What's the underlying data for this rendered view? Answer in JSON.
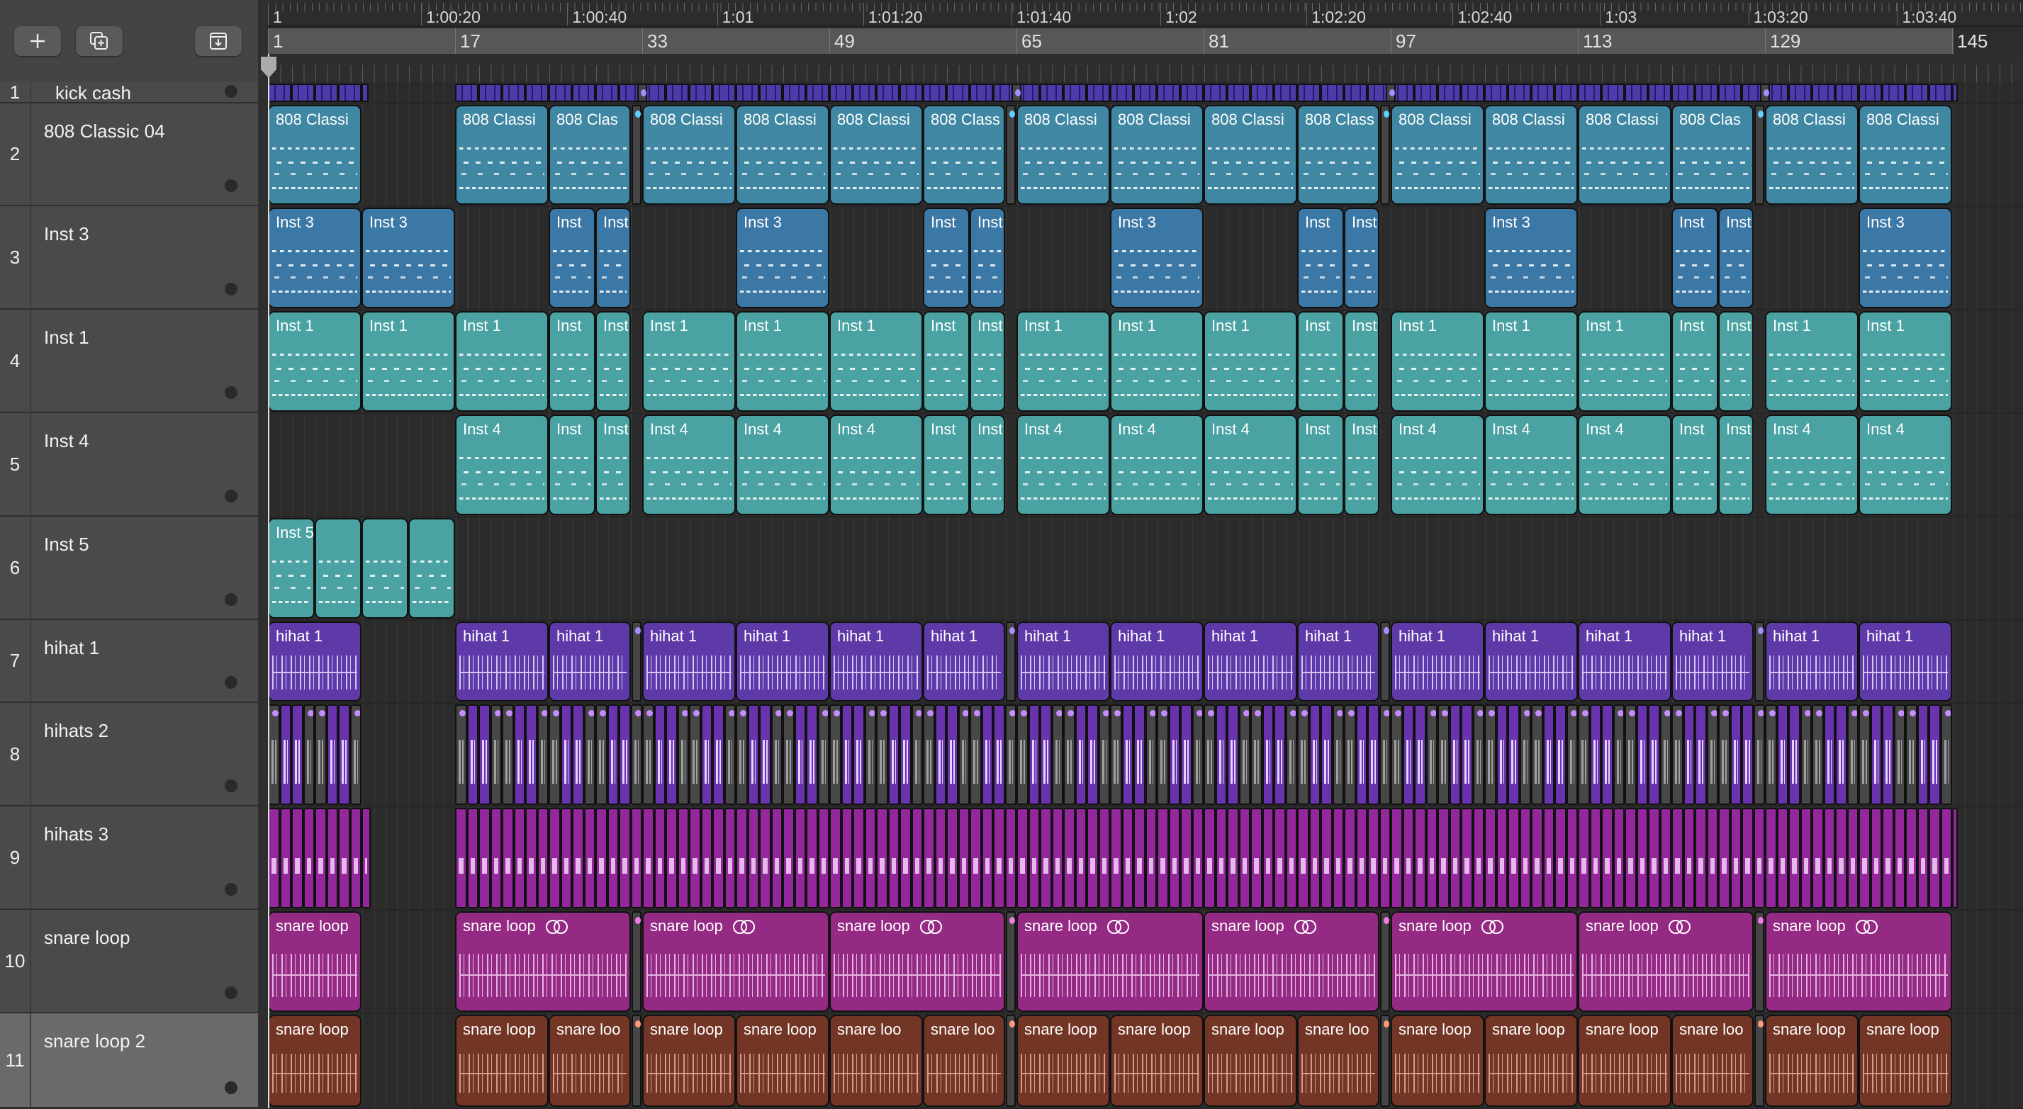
{
  "toolbar": {
    "buttons": [
      {
        "id": "add-track",
        "icon": "plus-icon"
      },
      {
        "id": "duplicate-track",
        "icon": "duplicate-plus-icon"
      },
      {
        "id": "import",
        "icon": "tray-download-icon"
      }
    ]
  },
  "ruler": {
    "time_labels": [
      {
        "text": "1",
        "bar": 1
      },
      {
        "text": "1:00:20",
        "bar": 14.1
      },
      {
        "text": "1:00:40",
        "bar": 26.6
      },
      {
        "text": "1:01",
        "bar": 39.4
      },
      {
        "text": "1:01:20",
        "bar": 51.9
      },
      {
        "text": "1:01:40",
        "bar": 64.6
      },
      {
        "text": "1:02",
        "bar": 77.3
      },
      {
        "text": "1:02:20",
        "bar": 89.8
      },
      {
        "text": "1:02:40",
        "bar": 102.3
      },
      {
        "text": "1:03",
        "bar": 114.9
      },
      {
        "text": "1:03:20",
        "bar": 127.6
      },
      {
        "text": "1:03:40",
        "bar": 140.3
      }
    ],
    "bar_labels": [
      "1",
      "17",
      "33",
      "49",
      "65",
      "81",
      "97",
      "113",
      "129",
      "145"
    ],
    "playhead_bar": 1
  },
  "tracks": [
    {
      "number": "1",
      "name": "kick cash",
      "kind": "kick",
      "color": "#4e3aa9",
      "segments": [
        [
          1,
          9.6
        ],
        [
          17,
          32.9
        ],
        [
          33,
          64.9
        ],
        [
          65,
          96.9
        ],
        [
          97,
          128.9
        ],
        [
          129,
          145.5
        ]
      ]
    },
    {
      "number": "2",
      "name": "808 Classic 04",
      "kind": "midi",
      "color": "#3f87a2",
      "regions": [
        {
          "s": 1,
          "l": 8,
          "label": "808 Classi"
        },
        {
          "s": 17,
          "l": 8,
          "label": "808 Classi"
        },
        {
          "s": 25,
          "l": 7,
          "label": "808 Clas"
        },
        {
          "s": 33,
          "l": 8,
          "label": "808 Classi"
        },
        {
          "s": 41,
          "l": 8,
          "label": "808 Classi"
        },
        {
          "s": 49,
          "l": 8,
          "label": "808 Classi"
        },
        {
          "s": 57,
          "l": 7,
          "label": "808 Class"
        },
        {
          "s": 65,
          "l": 8,
          "label": "808 Classi"
        },
        {
          "s": 73,
          "l": 8,
          "label": "808 Classi"
        },
        {
          "s": 81,
          "l": 8,
          "label": "808 Classi"
        },
        {
          "s": 89,
          "l": 7,
          "label": "808 Class"
        },
        {
          "s": 97,
          "l": 8,
          "label": "808 Classi"
        },
        {
          "s": 105,
          "l": 8,
          "label": "808 Classi"
        },
        {
          "s": 113,
          "l": 8,
          "label": "808 Classi"
        },
        {
          "s": 121,
          "l": 7,
          "label": "808 Clas"
        },
        {
          "s": 129,
          "l": 8,
          "label": "808 Classi"
        },
        {
          "s": 137,
          "l": 8,
          "label": "808 Classi"
        }
      ],
      "gap_dot": "#5fd0ff"
    },
    {
      "number": "3",
      "name": "Inst 3",
      "kind": "midi",
      "color": "#3c78a5",
      "regions": [
        {
          "s": 1,
          "l": 8,
          "label": "Inst 3"
        },
        {
          "s": 9,
          "l": 8,
          "label": "Inst 3"
        },
        {
          "s": 25,
          "l": 4,
          "label": "Inst"
        },
        {
          "s": 29,
          "l": 3,
          "label": "Inst"
        },
        {
          "s": 41,
          "l": 8,
          "label": "Inst 3"
        },
        {
          "s": 57,
          "l": 4,
          "label": "Inst"
        },
        {
          "s": 61,
          "l": 3,
          "label": "Inst"
        },
        {
          "s": 73,
          "l": 8,
          "label": "Inst 3"
        },
        {
          "s": 89,
          "l": 4,
          "label": "Inst"
        },
        {
          "s": 93,
          "l": 3,
          "label": "Inst"
        },
        {
          "s": 105,
          "l": 8,
          "label": "Inst 3"
        },
        {
          "s": 121,
          "l": 4,
          "label": "Inst"
        },
        {
          "s": 125,
          "l": 3,
          "label": "Inst"
        },
        {
          "s": 137,
          "l": 8,
          "label": "Inst 3"
        }
      ]
    },
    {
      "number": "4",
      "name": "Inst 1",
      "kind": "midi",
      "color": "#4aa2a2",
      "regions": [
        {
          "s": 1,
          "l": 8,
          "label": "Inst 1"
        },
        {
          "s": 9,
          "l": 8,
          "label": "Inst 1"
        },
        {
          "s": 17,
          "l": 8,
          "label": "Inst 1"
        },
        {
          "s": 25,
          "l": 4,
          "label": "Inst"
        },
        {
          "s": 29,
          "l": 3,
          "label": "Inst"
        },
        {
          "s": 33,
          "l": 8,
          "label": "Inst 1"
        },
        {
          "s": 41,
          "l": 8,
          "label": "Inst 1"
        },
        {
          "s": 49,
          "l": 8,
          "label": "Inst 1"
        },
        {
          "s": 57,
          "l": 4,
          "label": "Inst"
        },
        {
          "s": 61,
          "l": 3,
          "label": "Inst"
        },
        {
          "s": 65,
          "l": 8,
          "label": "Inst 1"
        },
        {
          "s": 73,
          "l": 8,
          "label": "Inst 1"
        },
        {
          "s": 81,
          "l": 8,
          "label": "Inst 1"
        },
        {
          "s": 89,
          "l": 4,
          "label": "Inst"
        },
        {
          "s": 93,
          "l": 3,
          "label": "Inst"
        },
        {
          "s": 97,
          "l": 8,
          "label": "Inst 1"
        },
        {
          "s": 105,
          "l": 8,
          "label": "Inst 1"
        },
        {
          "s": 113,
          "l": 8,
          "label": "Inst 1"
        },
        {
          "s": 121,
          "l": 4,
          "label": "Inst"
        },
        {
          "s": 125,
          "l": 3,
          "label": "Inst"
        },
        {
          "s": 129,
          "l": 8,
          "label": "Inst 1"
        },
        {
          "s": 137,
          "l": 8,
          "label": "Inst 1"
        }
      ]
    },
    {
      "number": "5",
      "name": "Inst 4",
      "kind": "midi",
      "color": "#4aa2a2",
      "regions": [
        {
          "s": 17,
          "l": 8,
          "label": "Inst 4"
        },
        {
          "s": 25,
          "l": 4,
          "label": "Inst"
        },
        {
          "s": 29,
          "l": 3,
          "label": "Inst"
        },
        {
          "s": 33,
          "l": 8,
          "label": "Inst 4"
        },
        {
          "s": 41,
          "l": 8,
          "label": "Inst 4"
        },
        {
          "s": 49,
          "l": 8,
          "label": "Inst 4"
        },
        {
          "s": 57,
          "l": 4,
          "label": "Inst"
        },
        {
          "s": 61,
          "l": 3,
          "label": "Inst"
        },
        {
          "s": 65,
          "l": 8,
          "label": "Inst 4"
        },
        {
          "s": 73,
          "l": 8,
          "label": "Inst 4"
        },
        {
          "s": 81,
          "l": 8,
          "label": "Inst 4"
        },
        {
          "s": 89,
          "l": 4,
          "label": "Inst"
        },
        {
          "s": 93,
          "l": 3,
          "label": "Inst"
        },
        {
          "s": 97,
          "l": 8,
          "label": "Inst 4"
        },
        {
          "s": 105,
          "l": 8,
          "label": "Inst 4"
        },
        {
          "s": 113,
          "l": 8,
          "label": "Inst 4"
        },
        {
          "s": 121,
          "l": 4,
          "label": "Inst"
        },
        {
          "s": 125,
          "l": 3,
          "label": "Inst"
        },
        {
          "s": 129,
          "l": 8,
          "label": "Inst 4"
        },
        {
          "s": 137,
          "l": 8,
          "label": "Inst 4"
        }
      ]
    },
    {
      "number": "6",
      "name": "Inst 5",
      "kind": "midi",
      "color": "#4aa2a2",
      "regions": [
        {
          "s": 1,
          "l": 4,
          "label": "Inst 5"
        },
        {
          "s": 5,
          "l": 4,
          "label": ""
        },
        {
          "s": 9,
          "l": 4,
          "label": ""
        },
        {
          "s": 13,
          "l": 4,
          "label": ""
        }
      ]
    },
    {
      "number": "7",
      "name": "hihat 1",
      "kind": "audio",
      "color": "#5e3aa8",
      "wave": "#e2d4ff",
      "regions": [
        {
          "s": 1,
          "l": 8,
          "label": "hihat 1"
        },
        {
          "s": 17,
          "l": 8,
          "label": "hihat 1"
        },
        {
          "s": 25,
          "l": 7,
          "label": "hihat 1"
        },
        {
          "s": 33,
          "l": 8,
          "label": "hihat 1"
        },
        {
          "s": 41,
          "l": 8,
          "label": "hihat 1"
        },
        {
          "s": 49,
          "l": 8,
          "label": "hihat 1"
        },
        {
          "s": 57,
          "l": 7,
          "label": "hihat 1"
        },
        {
          "s": 65,
          "l": 8,
          "label": "hihat 1"
        },
        {
          "s": 73,
          "l": 8,
          "label": "hihat 1"
        },
        {
          "s": 81,
          "l": 8,
          "label": "hihat 1"
        },
        {
          "s": 89,
          "l": 7,
          "label": "hihat 1"
        },
        {
          "s": 97,
          "l": 8,
          "label": "hihat 1"
        },
        {
          "s": 105,
          "l": 8,
          "label": "hihat 1"
        },
        {
          "s": 113,
          "l": 8,
          "label": "hihat 1"
        },
        {
          "s": 121,
          "l": 7,
          "label": "hihat 1"
        },
        {
          "s": 129,
          "l": 8,
          "label": "hihat 1"
        },
        {
          "s": 137,
          "l": 8,
          "label": "hihat 1"
        }
      ],
      "gap_dot": "#a58cff"
    },
    {
      "number": "8",
      "name": "hihats 2",
      "kind": "cells",
      "color": "#6a33ae",
      "muted_color": "#474747",
      "wave": "#e4d2ff",
      "segments": [
        [
          1,
          9
        ],
        [
          17,
          145
        ]
      ],
      "pattern": [
        "muted",
        "active",
        "active",
        "muted",
        "muted",
        "active",
        "active",
        "muted"
      ]
    },
    {
      "number": "9",
      "name": "hihats 3",
      "kind": "cells3",
      "color": "#93279b",
      "wave": "#e6b8ec",
      "segments": [
        [
          1,
          9.8
        ],
        [
          17,
          145.5
        ]
      ]
    },
    {
      "number": "10",
      "name": "snare loop",
      "kind": "audio",
      "color": "#952a85",
      "wave": "#ecc4ea",
      "regions": [
        {
          "s": 1,
          "l": 8,
          "label": "snare loop",
          "loop": false
        },
        {
          "s": 17,
          "l": 15,
          "label": "snare loop",
          "loop": true
        },
        {
          "s": 33,
          "l": 16,
          "label": "snare loop",
          "loop": true
        },
        {
          "s": 49,
          "l": 15,
          "label": "snare loop",
          "loop": true
        },
        {
          "s": 65,
          "l": 16,
          "label": "snare loop",
          "loop": true
        },
        {
          "s": 81,
          "l": 15,
          "label": "snare loop",
          "loop": true
        },
        {
          "s": 97,
          "l": 16,
          "label": "snare loop",
          "loop": true
        },
        {
          "s": 113,
          "l": 15,
          "label": "snare loop",
          "loop": true
        },
        {
          "s": 129,
          "l": 16,
          "label": "snare loop",
          "loop": true
        }
      ],
      "gap_dot": "#f27be6"
    },
    {
      "number": "11",
      "name": "snare loop 2",
      "kind": "audio",
      "color": "#733525",
      "wave": "#e0a897",
      "selected": true,
      "regions": [
        {
          "s": 1,
          "l": 8,
          "label": "snare loop"
        },
        {
          "s": 17,
          "l": 8,
          "label": "snare loop"
        },
        {
          "s": 25,
          "l": 7,
          "label": "snare loo"
        },
        {
          "s": 33,
          "l": 8,
          "label": "snare loop"
        },
        {
          "s": 41,
          "l": 8,
          "label": "snare loop"
        },
        {
          "s": 49,
          "l": 8,
          "label": "snare loo"
        },
        {
          "s": 57,
          "l": 7,
          "label": "snare loo"
        },
        {
          "s": 65,
          "l": 8,
          "label": "snare loop"
        },
        {
          "s": 73,
          "l": 8,
          "label": "snare loop"
        },
        {
          "s": 81,
          "l": 8,
          "label": "snare loop"
        },
        {
          "s": 89,
          "l": 7,
          "label": "snare loo"
        },
        {
          "s": 97,
          "l": 8,
          "label": "snare loop"
        },
        {
          "s": 105,
          "l": 8,
          "label": "snare loop"
        },
        {
          "s": 113,
          "l": 8,
          "label": "snare loop"
        },
        {
          "s": 121,
          "l": 7,
          "label": "snare loo"
        },
        {
          "s": 129,
          "l": 8,
          "label": "snare loop"
        },
        {
          "s": 137,
          "l": 8,
          "label": "snare loop"
        }
      ],
      "gap_dot": "#ff9a78"
    }
  ]
}
